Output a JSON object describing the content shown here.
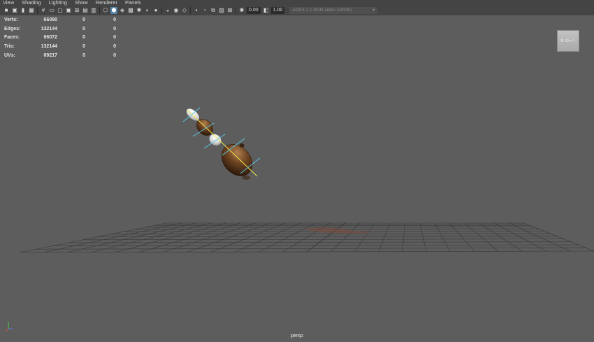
{
  "menubar": {
    "items": [
      "View",
      "Shading",
      "Lighting",
      "Show",
      "Renderer",
      "Panels"
    ]
  },
  "toolbar": {
    "icons": [
      "camera-select-icon",
      "camera-attributes-icon",
      "bookmark-icon",
      "image-plane-icon",
      "grid-icon",
      "film-gate-icon",
      "resolution-gate-icon",
      "gate-mask-icon",
      "field-chart-icon",
      "safe-action-icon",
      "safe-title-icon",
      "wireframe-icon",
      "smooth-shade-icon",
      "default-material-icon",
      "textured-icon",
      "use-lights-icon",
      "shadows-icon",
      "ambient-occlusion-icon",
      "motion-blur-icon",
      "anti-alias-icon",
      "depth-of-field-icon",
      "isolate-select-icon",
      "xray-icon",
      "xray-joints-icon",
      "backface-culling-icon",
      "wireframe-on-shaded-icon",
      "exposure-icon",
      "gamma-icon"
    ],
    "exposure_value": "0.00",
    "gamma_value": "1.00",
    "color_space": "ACES 1.0 SDR-video (sRGB)"
  },
  "hud": {
    "rows": [
      {
        "label": "Verts:",
        "v1": "66090",
        "v2": "0",
        "v3": "0"
      },
      {
        "label": "Edges:",
        "v1": "132144",
        "v2": "0",
        "v3": "0"
      },
      {
        "label": "Faces:",
        "v1": "66072",
        "v2": "0",
        "v3": "0"
      },
      {
        "label": "Tris:",
        "v1": "132144",
        "v2": "0",
        "v3": "0"
      },
      {
        "label": "UVs:",
        "v1": "69217",
        "v2": "0",
        "v3": "0"
      }
    ]
  },
  "viewcube": {
    "label": "RIGHT"
  },
  "camera": {
    "name": "persp"
  },
  "colors": {
    "viewport_bg": "#5d5d5d",
    "toolbar_bg": "#444444",
    "selection_blue": "#5285a6",
    "model_brown": "#5e3a1c",
    "model_white": "#e8e8e8",
    "manipulator_cyan": "#59c8e6",
    "joint_yellow": "#f2e84a",
    "grid_line": "#383838"
  }
}
